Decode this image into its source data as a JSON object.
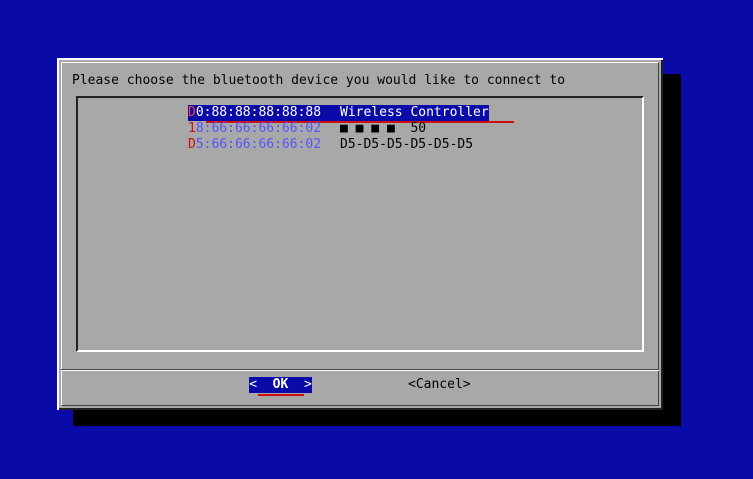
{
  "dialog": {
    "prompt": "Please choose the bluetooth device you would like to connect to",
    "devices": [
      {
        "mac_hotkey": "D",
        "mac_rest": "0:88:88:88:88:88",
        "name": "Wireless Controller",
        "selected": true
      },
      {
        "mac_hotkey": "1",
        "mac_rest": "8:66:66:66:66:02",
        "name": "■ ■ ■ ■  50",
        "selected": false
      },
      {
        "mac_hotkey": "D",
        "mac_rest": "5:66:66:66:66:02",
        "name": "D5-D5-D5-D5-D5-D5",
        "selected": false
      }
    ],
    "ok_left": "<",
    "ok_label": "OK",
    "ok_right": ">",
    "cancel_left": "<",
    "cancel_label": "Cancel",
    "cancel_right": ">"
  },
  "colors": {
    "background": "#0a0aa8",
    "dialog": "#a8a8a8",
    "highlight": "#0a0aa8",
    "hotkey": "#d01010",
    "mac_text": "#5555ff"
  }
}
